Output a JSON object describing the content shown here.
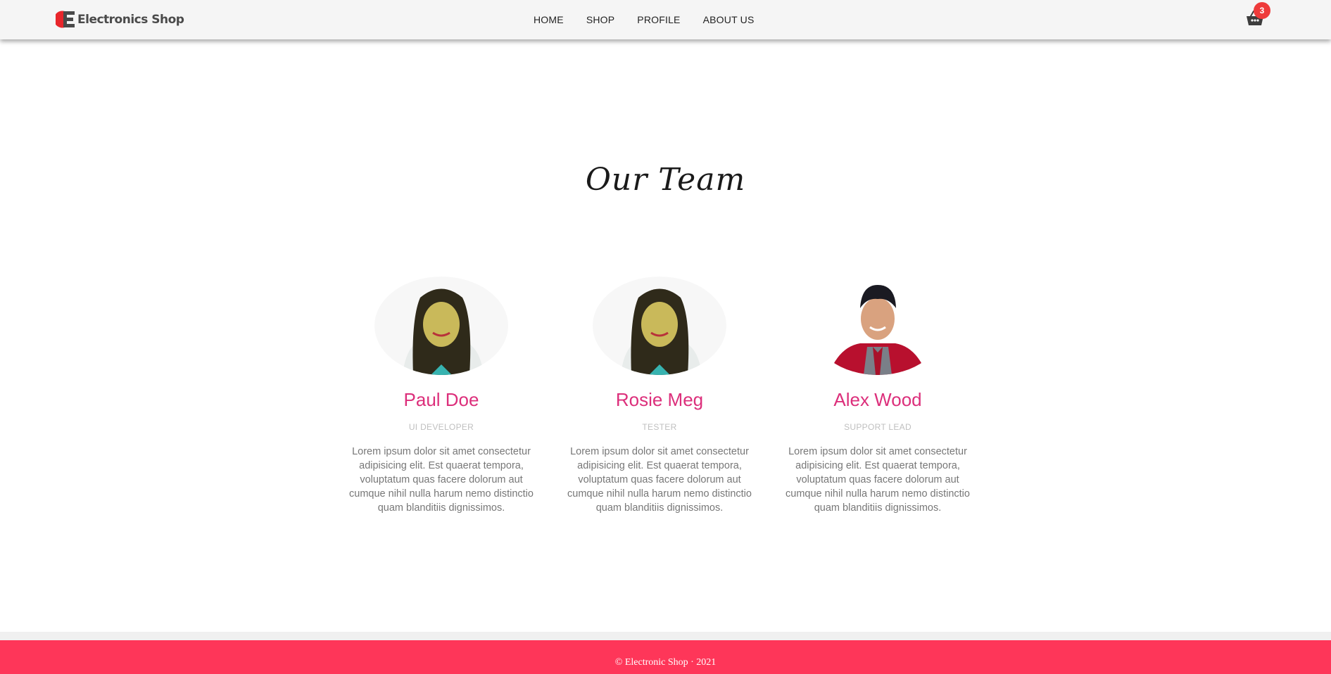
{
  "header": {
    "brand_name": "Electronics Shop",
    "logo_icon": "brand-e-logo",
    "nav": [
      {
        "label": "HOME"
      },
      {
        "label": "SHOP"
      },
      {
        "label": "PROFILE"
      },
      {
        "label": "ABOUT US"
      }
    ],
    "cart_icon": "basket-icon",
    "cart_count": "3"
  },
  "section": {
    "title": "Our Team"
  },
  "team": [
    {
      "name": "Paul Doe",
      "role": "UI DEVELOPER",
      "bio": "Lorem ipsum dolor sit amet consectetur adipisicing elit. Est quaerat tempora, voluptatum quas facere dolorum aut cumque nihil nulla harum nemo distinctio quam blanditiis dignissimos."
    },
    {
      "name": "Rosie Meg",
      "role": "TESTER",
      "bio": "Lorem ipsum dolor sit amet consectetur adipisicing elit. Est quaerat tempora, voluptatum quas facere dolorum aut cumque nihil nulla harum nemo distinctio quam blanditiis dignissimos."
    },
    {
      "name": "Alex Wood",
      "role": "SUPPORT LEAD",
      "bio": "Lorem ipsum dolor sit amet consectetur adipisicing elit. Est quaerat tempora, voluptatum quas facere dolorum aut cumque nihil nulla harum nemo distinctio quam blanditiis dignissimos."
    }
  ],
  "footer": {
    "text": "© Electronic Shop · 2021"
  },
  "colors": {
    "accent": "#dc2f7b",
    "footer_bg": "#fe3659",
    "badge": "#ee3b3b",
    "header_bg": "#f5f5f5"
  }
}
